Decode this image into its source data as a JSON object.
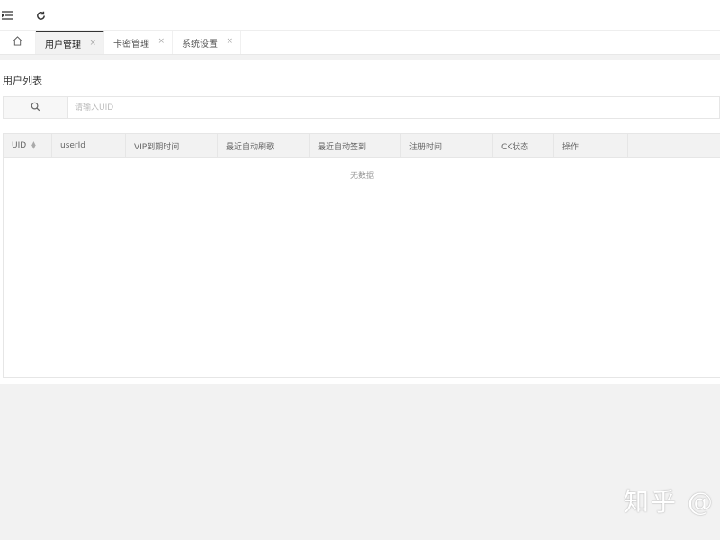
{
  "tabs": [
    {
      "label": "用户管理",
      "active": true
    },
    {
      "label": "卡密管理",
      "active": false
    },
    {
      "label": "系统设置",
      "active": false
    }
  ],
  "tab_close_glyph": "×",
  "card": {
    "title": "用户列表"
  },
  "search": {
    "placeholder": "请输入UID",
    "value": ""
  },
  "table": {
    "columns": [
      "UID",
      "userId",
      "VIP到期时间",
      "最近自动刷歌",
      "最近自动签到",
      "注册时间",
      "CK状态",
      "操作"
    ],
    "empty_text": "无数据"
  },
  "watermark": {
    "text": "知乎 @"
  },
  "icons": {
    "menu": "menu-fold-icon",
    "refresh": "refresh-icon",
    "home": "home-icon",
    "search": "search-icon",
    "sort": "sort-icon"
  },
  "colors": {
    "active_tab_border": "#333333",
    "page_background": "#f2f2f2"
  }
}
